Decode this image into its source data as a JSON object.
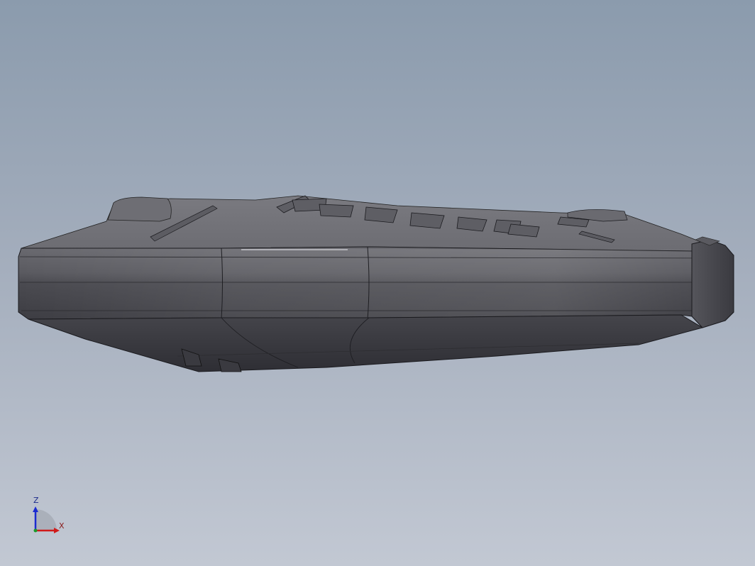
{
  "viewport": {
    "background_top": "#8b9bad",
    "background_bottom": "#c2c8d3",
    "model_color": "#4a4a4e"
  },
  "triad": {
    "z_label": "Z",
    "x_label": "X",
    "z_color": "#1a2ad0",
    "x_color": "#d01a1a",
    "origin_color": "#1a9a2a"
  }
}
